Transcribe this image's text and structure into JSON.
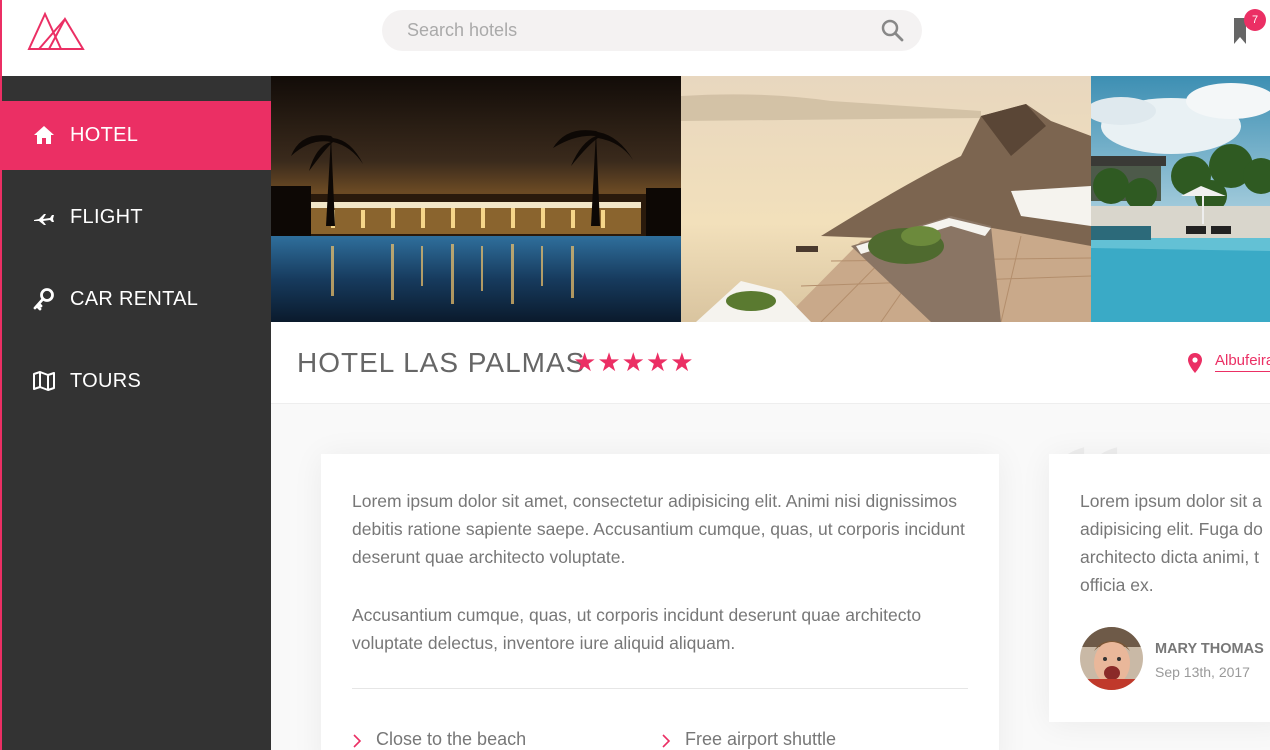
{
  "header": {
    "search_placeholder": "Search hotels",
    "bookmark_count": "7"
  },
  "sidebar": {
    "items": [
      {
        "label": "HOTEL",
        "icon": "home-icon",
        "active": true
      },
      {
        "label": "FLIGHT",
        "icon": "airplane-icon",
        "active": false
      },
      {
        "label": "CAR RENTAL",
        "icon": "key-icon",
        "active": false
      },
      {
        "label": "TOURS",
        "icon": "map-icon",
        "active": false
      }
    ]
  },
  "hotel": {
    "name": "HOTEL LAS PALMAS",
    "stars": 5,
    "location": "Albufeira"
  },
  "description": {
    "p1": "Lorem ipsum dolor sit amet, consectetur adipisicing elit. Animi nisi dignissimos debitis ratione sapiente saepe. Accusantium cumque, quas, ut corporis incidunt deserunt quae architecto voluptate.",
    "p2": "Accusantium cumque, quas, ut corporis incidunt deserunt quae architecto voluptate delectus, inventore iure aliquid aliquam.",
    "features": [
      "Close to the beach",
      "Free airport shuttle"
    ]
  },
  "review": {
    "lines": [
      "Lorem ipsum dolor sit a",
      "adipisicing elit. Fuga do",
      "architecto dicta animi, t",
      "officia ex."
    ],
    "name": "MARY THOMAS",
    "date": "Sep 13th, 2017"
  },
  "colors": {
    "accent": "#eb2f64",
    "sidebar": "#333333"
  }
}
